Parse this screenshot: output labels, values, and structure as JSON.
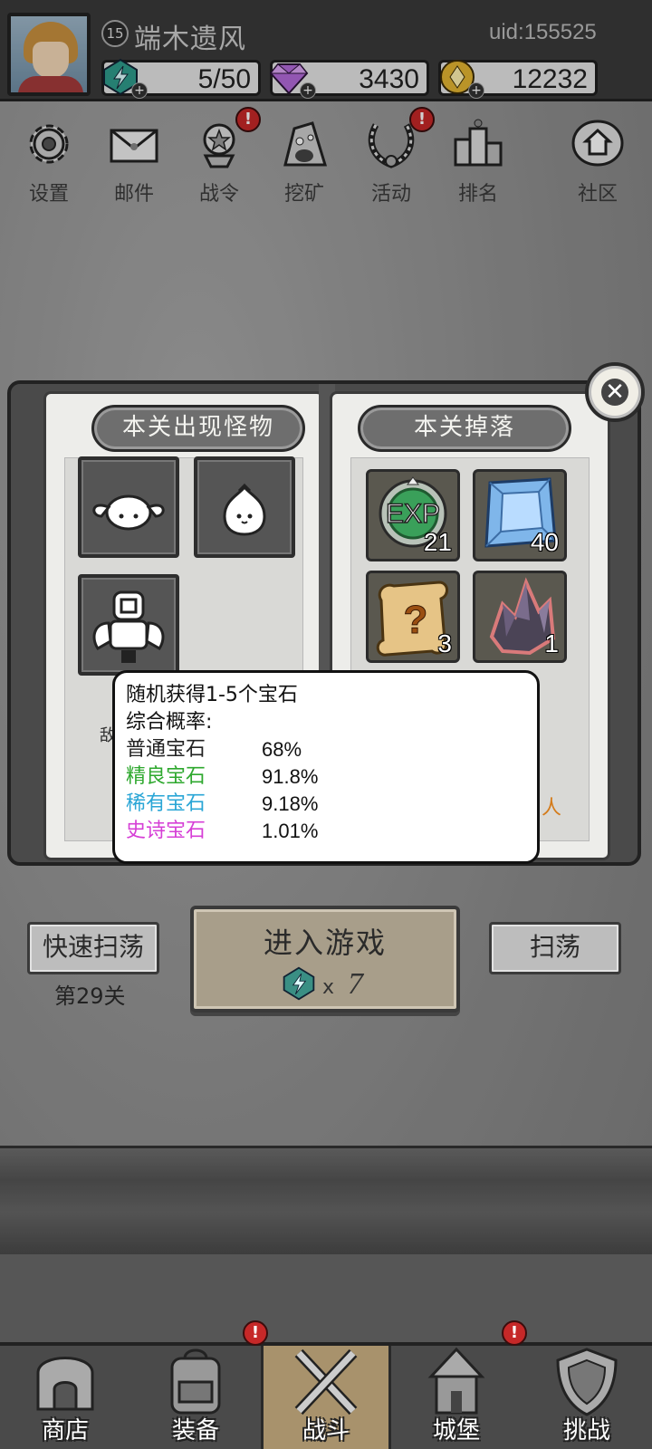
{
  "player": {
    "level": "15",
    "name": "端木遗风",
    "uid": "uid:155525"
  },
  "resources": {
    "energy": "5/50",
    "gems": "3430",
    "gold": "12232"
  },
  "menu": [
    {
      "label": "设置",
      "icon": "gear-icon"
    },
    {
      "label": "邮件",
      "icon": "mail-icon"
    },
    {
      "label": "战令",
      "icon": "battle-pass-icon"
    },
    {
      "label": "挖矿",
      "icon": "mining-icon"
    },
    {
      "label": "活动",
      "icon": "event-wreath-icon"
    },
    {
      "label": "排名",
      "icon": "ranking-icon"
    },
    {
      "label": "社区",
      "icon": "community-icon"
    }
  ],
  "alert_mark": "!",
  "book": {
    "left_title": "本关出现怪物",
    "right_title": "本关掉落",
    "monsters": [
      "bunny-monster-icon",
      "dumpling-monster-icon",
      "golem-monster-icon"
    ],
    "drops": [
      {
        "icon": "exp-orb-icon",
        "badge": "EXP",
        "count": "21"
      },
      {
        "icon": "blue-gem-icon",
        "count": "40"
      },
      {
        "icon": "mystery-scroll-icon",
        "count": "3"
      },
      {
        "icon": "crystal-ore-icon",
        "count": "1"
      }
    ],
    "partial_left": "敌",
    "partial_right": "人"
  },
  "tooltip": {
    "line1": "随机获得1-5个宝石",
    "line2": "综合概率:",
    "rows": [
      {
        "name": "普通宝石",
        "pct": "68%",
        "color": "#111111"
      },
      {
        "name": "精良宝石",
        "pct": "91.8%",
        "color": "#2ea82e"
      },
      {
        "name": "稀有宝石",
        "pct": "9.18%",
        "color": "#2aa6d6"
      },
      {
        "name": "史诗宝石",
        "pct": "1.01%",
        "color": "#d63fd6"
      }
    ]
  },
  "actions": {
    "quick_sweep": "快速扫荡",
    "stage": "第29关",
    "enter": "进入游戏",
    "cost_x": "x",
    "cost": "7",
    "sweep": "扫荡"
  },
  "nav": [
    {
      "label": "商店",
      "icon": "shop-icon"
    },
    {
      "label": "装备",
      "icon": "backpack-icon"
    },
    {
      "label": "战斗",
      "icon": "crossed-swords-icon"
    },
    {
      "label": "城堡",
      "icon": "castle-icon"
    },
    {
      "label": "挑战",
      "icon": "shield-icon"
    }
  ]
}
